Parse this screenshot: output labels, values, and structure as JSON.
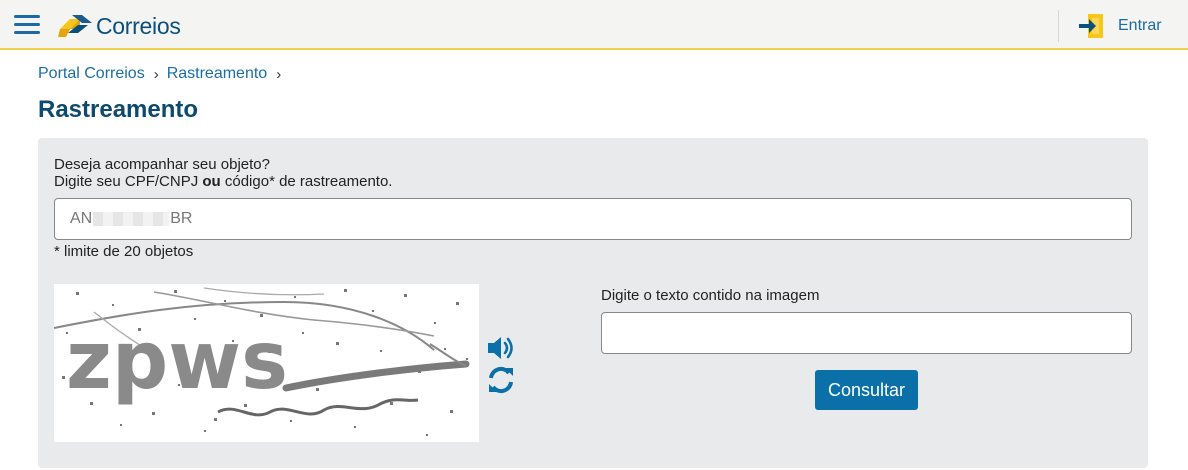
{
  "header": {
    "logo_text": "Correios",
    "login_label": "Entrar",
    "icons": {
      "menu": "hamburger-menu-icon",
      "logo": "correios-logo-icon",
      "login": "sign-in-icon"
    },
    "colors": {
      "bar_bg": "#f4f4f2",
      "bar_border": "#f2cf4a",
      "brand_blue": "#0b4f7c",
      "brand_yellow": "#f6c61a"
    }
  },
  "breadcrumb": {
    "items": [
      "Portal Correios",
      "Rastreamento"
    ],
    "separator": "›"
  },
  "page": {
    "title": "Rastreamento"
  },
  "form": {
    "intro_line1": "Deseja acompanhar seu objeto?",
    "intro_line2_prefix": "Digite seu CPF/CNPJ ",
    "intro_line2_bold": "ou",
    "intro_line2_suffix": " código* de rastreamento.",
    "tracking_prefix": "AN",
    "tracking_suffix": "BR",
    "limit_note": "* limite de 20 objetos",
    "captcha_text": "zpws",
    "captcha_label": "Digite o texto contido na imagem",
    "captcha_value": "",
    "submit_label": "Consultar",
    "icons": {
      "audio": "speaker-audio-icon",
      "refresh": "refresh-icon"
    },
    "colors": {
      "panel_bg": "#e9eaec",
      "button_bg": "#0b6fa8",
      "title": "#0d4a6e"
    }
  }
}
